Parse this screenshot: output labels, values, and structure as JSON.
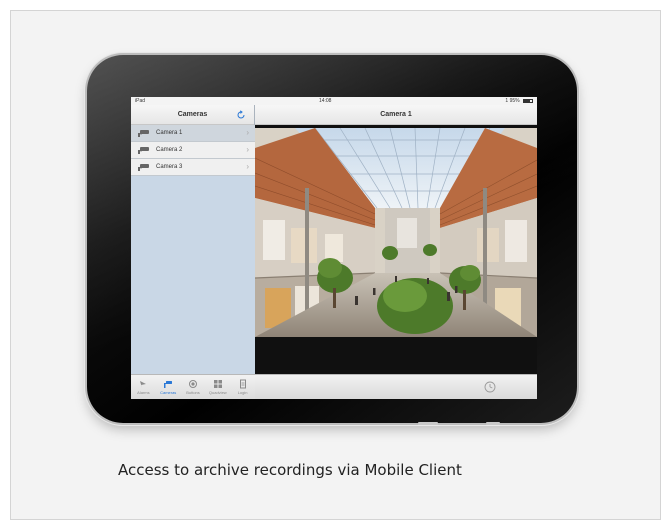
{
  "caption": "Access to archive recordings via Mobile Client",
  "statusbar": {
    "carrier": "iPad",
    "time": "14:08",
    "battery_text": "1 95%"
  },
  "sidebar": {
    "title": "Cameras",
    "cameras": [
      {
        "label": "Camera 1",
        "selected": true
      },
      {
        "label": "Camera 2",
        "selected": false
      },
      {
        "label": "Camera 3",
        "selected": false
      }
    ],
    "tabs": [
      {
        "label": "Alarms",
        "icon": "alarm-icon",
        "active": false
      },
      {
        "label": "Cameras",
        "icon": "camera-icon",
        "active": true
      },
      {
        "label": "Buttons",
        "icon": "button-icon",
        "active": false
      },
      {
        "label": "Quadview",
        "icon": "quadview-icon",
        "active": false
      },
      {
        "label": "Login",
        "icon": "login-icon",
        "active": false
      }
    ]
  },
  "detail": {
    "title": "Camera 1"
  },
  "colors": {
    "accent": "#2a78d6",
    "sidebar_bg": "#c9d7e6"
  }
}
